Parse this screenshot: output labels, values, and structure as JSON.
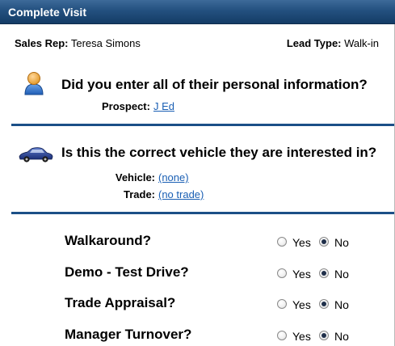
{
  "header": {
    "title": "Complete Visit"
  },
  "visit": {
    "sales_rep_label": "Sales Rep:",
    "sales_rep": "Teresa Simons",
    "lead_type_label": "Lead Type:",
    "lead_type": "Walk-in"
  },
  "personal": {
    "icon": "person-icon",
    "question": "Did you enter all of their personal information?",
    "prospect_label": "Prospect:",
    "prospect_link": "J Ed"
  },
  "vehicle": {
    "icon": "car-icon",
    "question": "Is this the correct vehicle they are interested in?",
    "vehicle_label": "Vehicle:",
    "vehicle_link": "(none)",
    "trade_label": "Trade:",
    "trade_link": "(no trade)"
  },
  "checklist": [
    {
      "label": "Walkaround?",
      "yes": "Yes",
      "no": "No",
      "selected": "No"
    },
    {
      "label": "Demo - Test Drive?",
      "yes": "Yes",
      "no": "No",
      "selected": "No"
    },
    {
      "label": "Trade Appraisal?",
      "yes": "Yes",
      "no": "No",
      "selected": "No"
    },
    {
      "label": "Manager Turnover?",
      "yes": "Yes",
      "no": "No",
      "selected": "No"
    }
  ],
  "colors": {
    "header": "#23507f",
    "divider": "#1b4f87",
    "link": "#1a5fb4"
  }
}
